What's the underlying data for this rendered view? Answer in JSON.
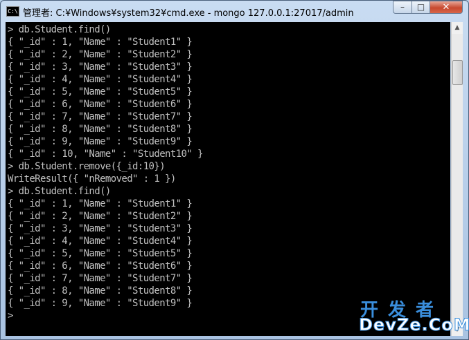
{
  "window": {
    "title": "管理者: C:¥Windows¥system32¥cmd.exe - mongo  127.0.0.1:27017/admin",
    "icon_label": "C:\\",
    "controls": {
      "minimize": "–",
      "maximize": "□",
      "close": "✕"
    }
  },
  "console": {
    "lines": [
      "> db.Student.find()",
      "{ \"_id\" : 1, \"Name\" : \"Student1\" }",
      "{ \"_id\" : 2, \"Name\" : \"Student2\" }",
      "{ \"_id\" : 3, \"Name\" : \"Student3\" }",
      "{ \"_id\" : 4, \"Name\" : \"Student4\" }",
      "{ \"_id\" : 5, \"Name\" : \"Student5\" }",
      "{ \"_id\" : 6, \"Name\" : \"Student6\" }",
      "{ \"_id\" : 7, \"Name\" : \"Student7\" }",
      "{ \"_id\" : 8, \"Name\" : \"Student8\" }",
      "{ \"_id\" : 9, \"Name\" : \"Student9\" }",
      "{ \"_id\" : 10, \"Name\" : \"Student10\" }",
      "> db.Student.remove({_id:10})",
      "WriteResult({ \"nRemoved\" : 1 })",
      "> db.Student.find()",
      "{ \"_id\" : 1, \"Name\" : \"Student1\" }",
      "{ \"_id\" : 2, \"Name\" : \"Student2\" }",
      "{ \"_id\" : 3, \"Name\" : \"Student3\" }",
      "{ \"_id\" : 4, \"Name\" : \"Student4\" }",
      "{ \"_id\" : 5, \"Name\" : \"Student5\" }",
      "{ \"_id\" : 6, \"Name\" : \"Student6\" }",
      "{ \"_id\" : 7, \"Name\" : \"Student7\" }",
      "{ \"_id\" : 8, \"Name\" : \"Student8\" }",
      "{ \"_id\" : 9, \"Name\" : \"Student9\" }",
      ">"
    ]
  },
  "scrollbar": {
    "up_arrow": "▲",
    "down_arrow": "▼"
  },
  "watermark": {
    "top": "开发者",
    "bottom": "DevZe.CoM"
  },
  "colors": {
    "console_bg": "#000000",
    "console_text": "#c0c0c0",
    "titlebar": "#b9d1ea",
    "close_button": "#c7492f"
  }
}
